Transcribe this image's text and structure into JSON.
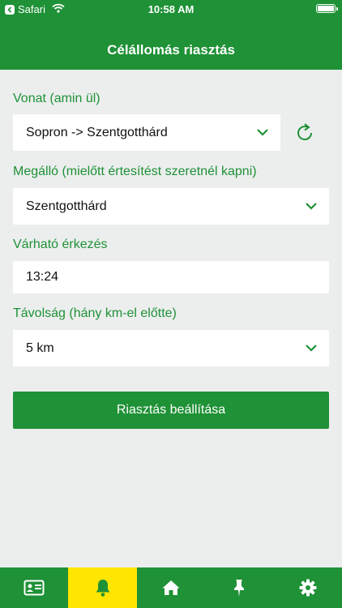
{
  "status_bar": {
    "back_app": "Safari",
    "time": "10:58 AM",
    "battery_level": 1.0
  },
  "header": {
    "title": "Célállomás riasztás"
  },
  "form": {
    "train": {
      "label": "Vonat (amin ül)",
      "value": "Sopron -> Szentgotthárd"
    },
    "stop": {
      "label": "Megálló (mielőtt értesítést szeretnél kapni)",
      "value": "Szentgotthárd"
    },
    "arrival": {
      "label": "Várható érkezés",
      "value": "13:24"
    },
    "distance": {
      "label": "Távolság (hány km-el előtte)",
      "value": "5 km"
    },
    "submit_label": "Riasztás beállítása"
  },
  "tabs": [
    {
      "icon": "id-card-icon",
      "active": false
    },
    {
      "icon": "bell-icon",
      "active": true
    },
    {
      "icon": "home-icon",
      "active": false
    },
    {
      "icon": "pin-icon",
      "active": false
    },
    {
      "icon": "gear-icon",
      "active": false
    }
  ],
  "colors": {
    "brand": "#1f9136",
    "active_tab": "#ffe600",
    "background": "#eceeee"
  }
}
